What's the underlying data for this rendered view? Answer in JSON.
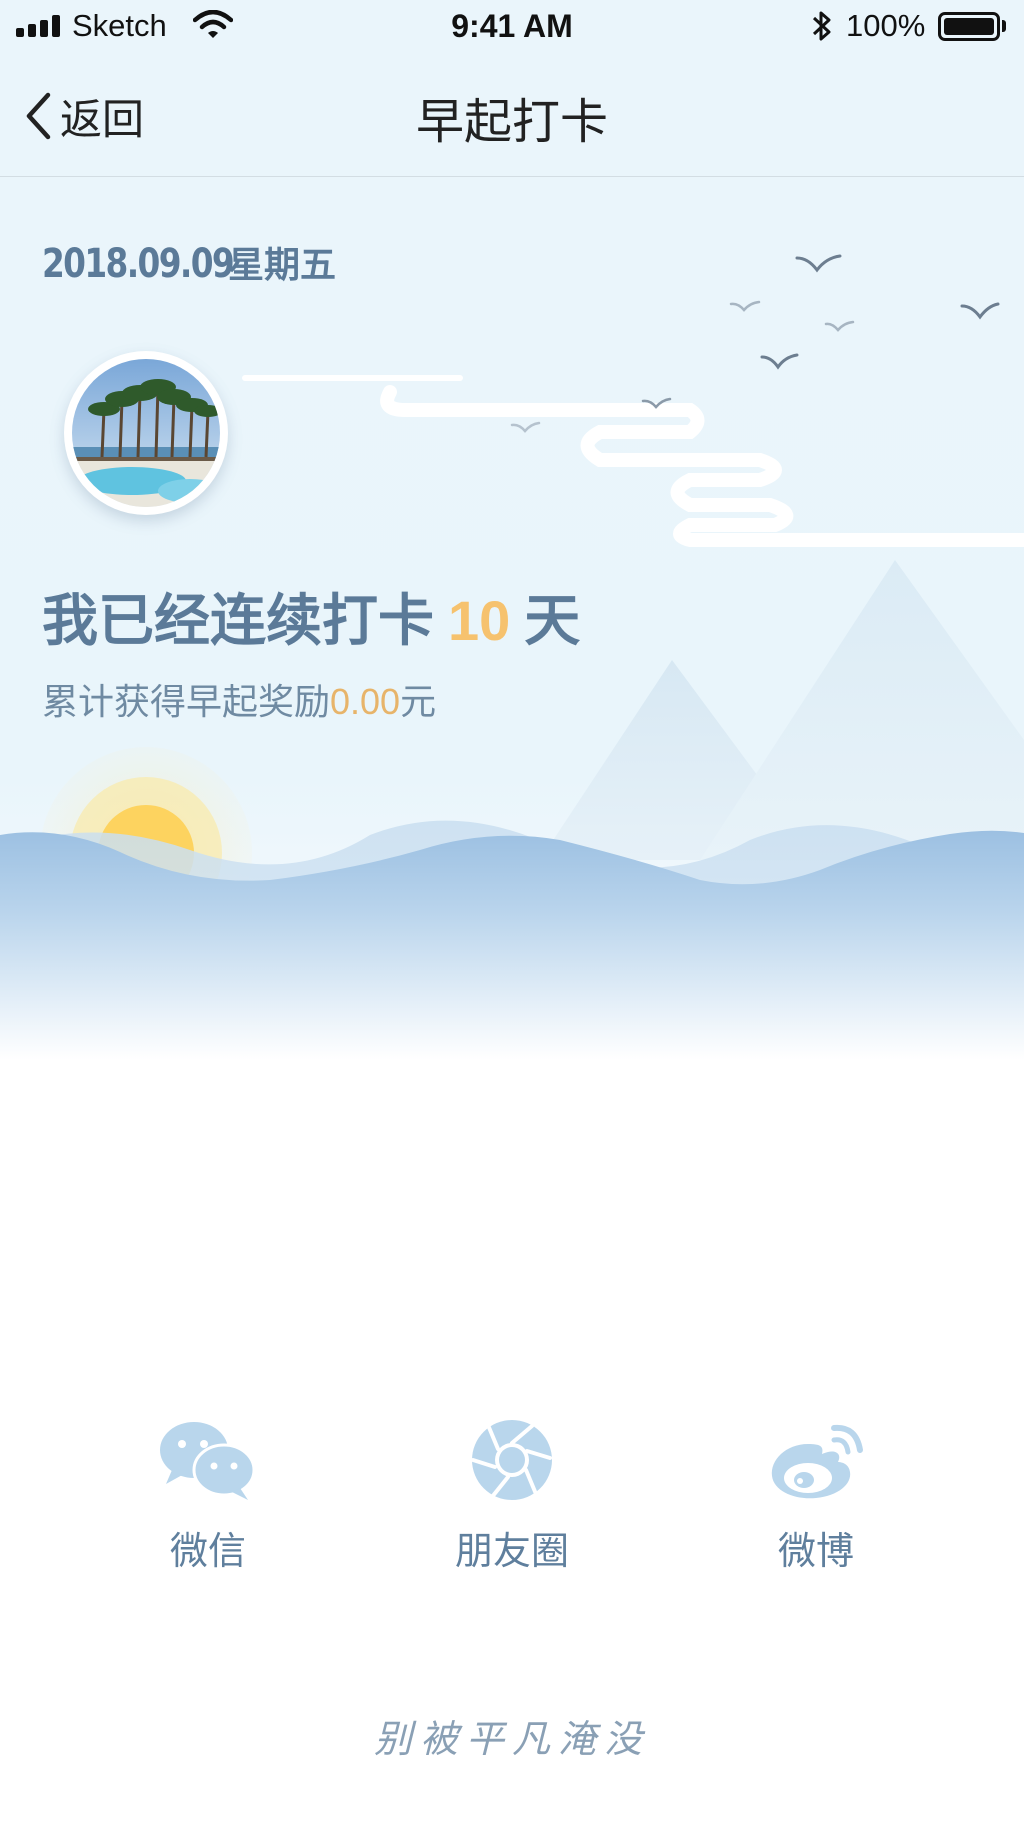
{
  "status_bar": {
    "carrier": "Sketch",
    "time": "9:41 AM",
    "battery": "100%"
  },
  "nav": {
    "back_label": "返回",
    "title": "早起打卡"
  },
  "checkin": {
    "date": "2018.09.09",
    "weekday": "星期五",
    "streak_prefix": "我已经连续打卡",
    "streak_days": "10",
    "streak_suffix": "天",
    "reward_prefix": "累计获得早起奖励",
    "reward_amount": "0.00",
    "reward_unit": "元"
  },
  "share": {
    "items": [
      {
        "label": "微信",
        "icon": "wechat-icon"
      },
      {
        "label": "朋友圈",
        "icon": "moments-icon"
      },
      {
        "label": "微博",
        "icon": "weibo-icon"
      }
    ]
  },
  "slogan": "别被平凡淹没",
  "colors": {
    "accent_text": "#5b7a98",
    "highlight": "#f6c26e",
    "icon_blue": "#b9d6ec",
    "background_sky": "#eaf5fb"
  }
}
